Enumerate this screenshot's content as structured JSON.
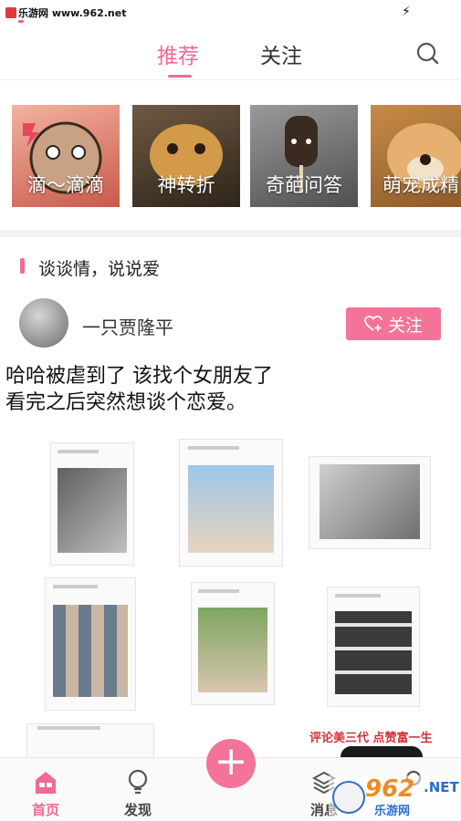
{
  "status_bar": {
    "watermark": "乐游网 www.962.net"
  },
  "top_tabs": {
    "recommend": "推荐",
    "follow": "关注"
  },
  "categories": [
    {
      "label": "滴～滴滴"
    },
    {
      "label": "神转折"
    },
    {
      "label": "奇葩问答"
    },
    {
      "label": "萌宠成精"
    }
  ],
  "section": {
    "title": "谈谈情，说说爱"
  },
  "post": {
    "author": "一只贾隆平",
    "follow_label": "关注",
    "text_line1": "哈哈被虐到了 该找个女朋友了",
    "text_line2": "看完之后突然想谈个恋爱。",
    "bottom_caption": "评论美三代 点赞富一生"
  },
  "bottom_nav": {
    "home": "首页",
    "discover": "发现",
    "messages": "消息",
    "me": ""
  },
  "watermark_br": {
    "big": "962",
    "net": ".NET",
    "small": "乐游网"
  },
  "colors": {
    "accent": "#f06a94",
    "button": "#f37399"
  }
}
